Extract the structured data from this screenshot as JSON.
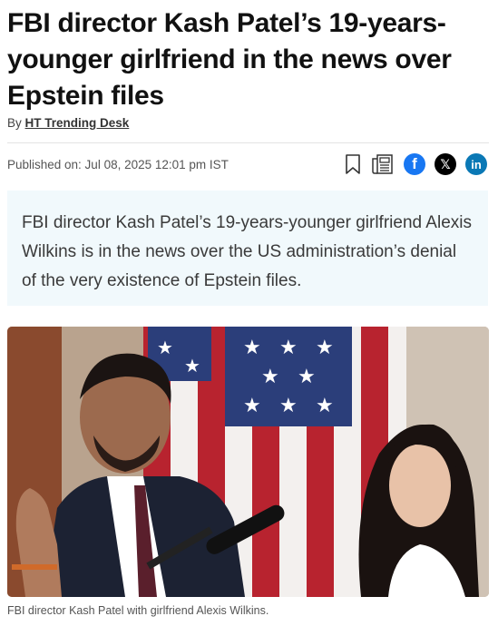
{
  "article": {
    "headline": "FBI director Kash Patel’s 19-years-younger girlfriend in the news over Epstein files",
    "byline_prefix": "By",
    "author": "HT Trending Desk",
    "published": "Published on: Jul 08, 2025 12:01 pm IST",
    "summary": "FBI director Kash Patel’s 19-years-younger girlfriend Alexis Wilkins is in the news over the US administration’s denial of the very existence of Epstein files.",
    "caption": "FBI director Kash Patel with girlfriend Alexis Wilkins."
  },
  "share": {
    "icons": [
      "bookmark-icon",
      "news-icon",
      "facebook-icon",
      "x-icon",
      "linkedin-icon"
    ],
    "facebook_glyph": "f",
    "x_glyph": "𝕏",
    "linkedin_glyph": "in",
    "colors": {
      "facebook": "#1877f2",
      "x": "#000000",
      "linkedin": "#0a78b5"
    }
  },
  "colors": {
    "summary_bg": "#f1f9fc",
    "text": "#1a1a1a"
  }
}
